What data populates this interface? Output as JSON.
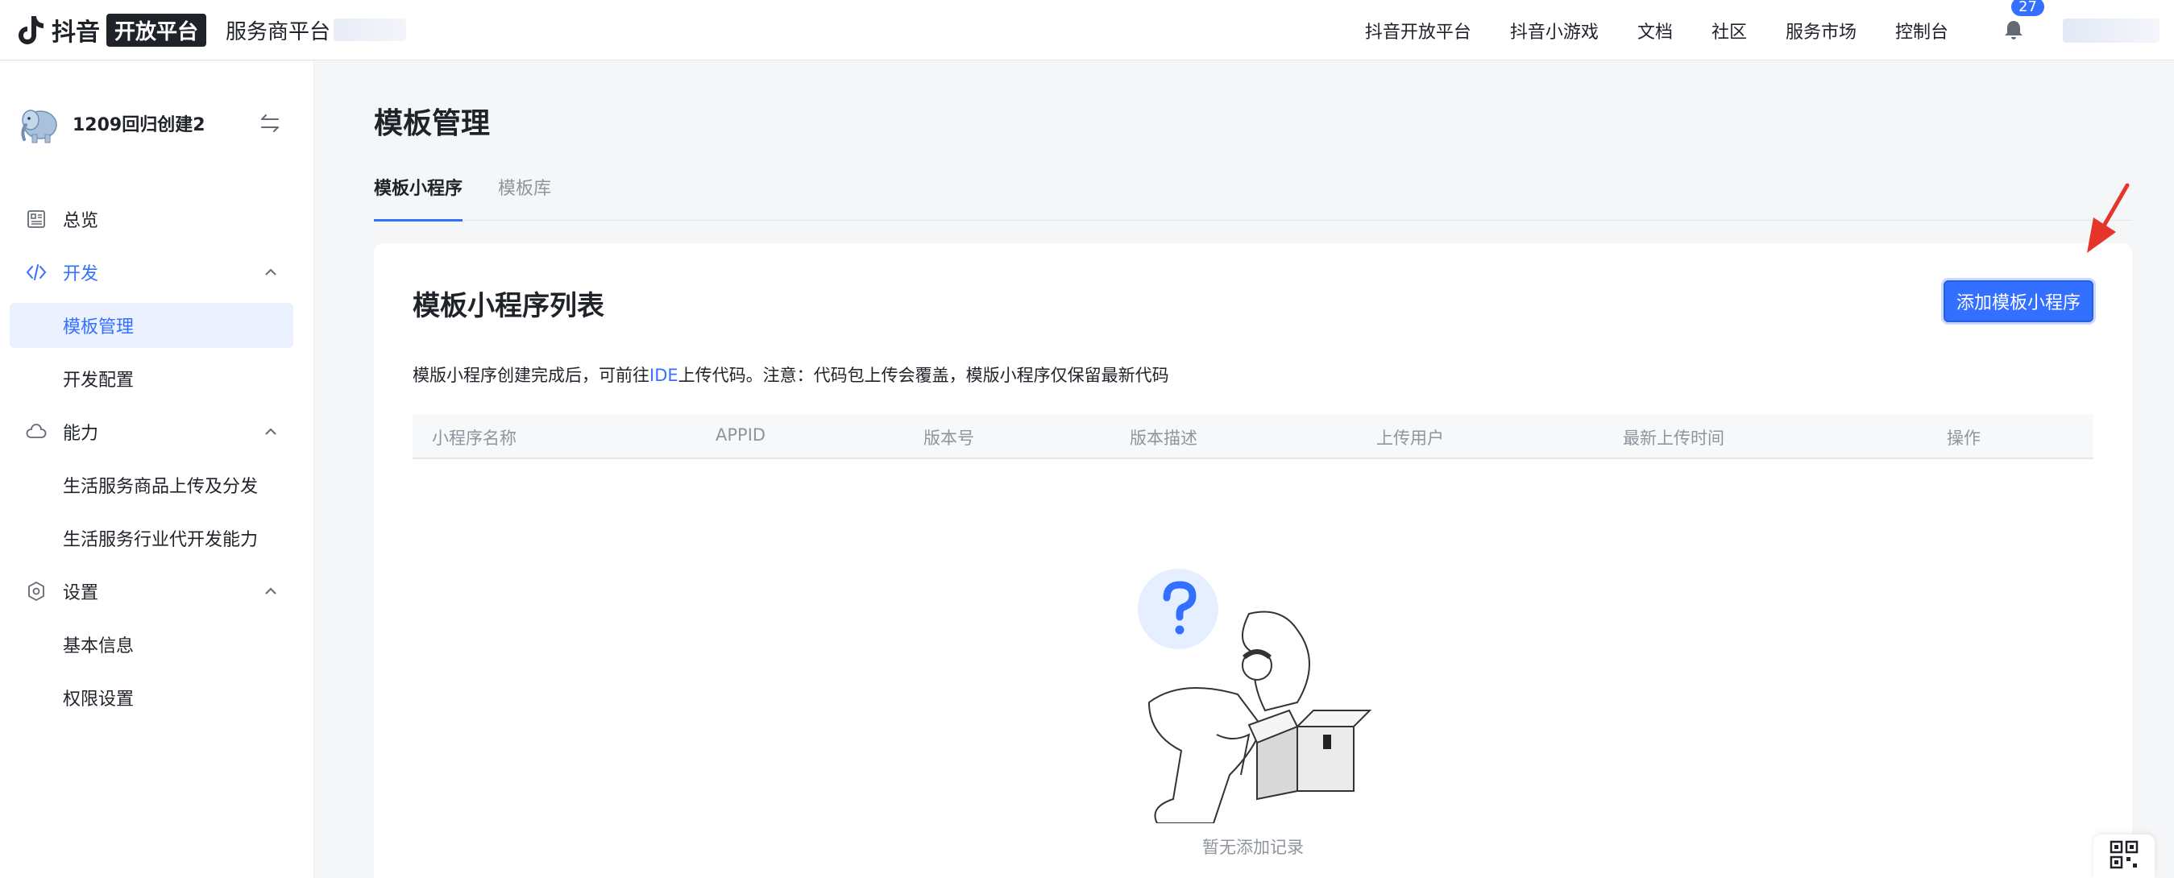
{
  "topbar": {
    "brand": "抖音",
    "brand_badge": "开放平台",
    "platform_name": "服务商平台",
    "nav": [
      "抖音开放平台",
      "抖音小游戏",
      "文档",
      "社区",
      "服务市场",
      "控制台"
    ],
    "notification_count": "27"
  },
  "sidebar": {
    "app_name": "1209回归创建2",
    "menu": {
      "overview": "总览",
      "dev": "开发",
      "dev_sub": [
        "模板管理",
        "开发配置"
      ],
      "ability": "能力",
      "ability_sub": [
        "生活服务商品上传及分发",
        "生活服务行业代开发能力"
      ],
      "settings": "设置",
      "settings_sub": [
        "基本信息",
        "权限设置"
      ]
    },
    "active_item": "模板管理"
  },
  "main": {
    "page_title": "模板管理",
    "tabs": [
      "模板小程序",
      "模板库"
    ],
    "active_tab": "模板小程序",
    "card": {
      "title": "模板小程序列表",
      "add_button": "添加模板小程序",
      "notice_prefix": "模版小程序创建完成后，可前往",
      "notice_link": "IDE",
      "notice_suffix": "上传代码。注意：代码包上传会覆盖，模版小程序仅保留最新代码",
      "columns": [
        "小程序名称",
        "APPID",
        "版本号",
        "版本描述",
        "上传用户",
        "最新上传时间",
        "操作"
      ],
      "rows": [],
      "empty_text": "暂无添加记录"
    }
  },
  "icons": [
    "tiktok-logo-icon",
    "bell-icon",
    "elephant-avatar-icon",
    "swap-icon",
    "overview-icon",
    "code-icon",
    "ability-icon",
    "settings-icon",
    "chevron-up-icon",
    "question-icon",
    "qr-code-icon",
    "red-arrow-icon"
  ],
  "colors": {
    "accent": "#3370ff",
    "arrow": "#e5352b",
    "text": "#1f2329",
    "muted": "#8f959e"
  }
}
